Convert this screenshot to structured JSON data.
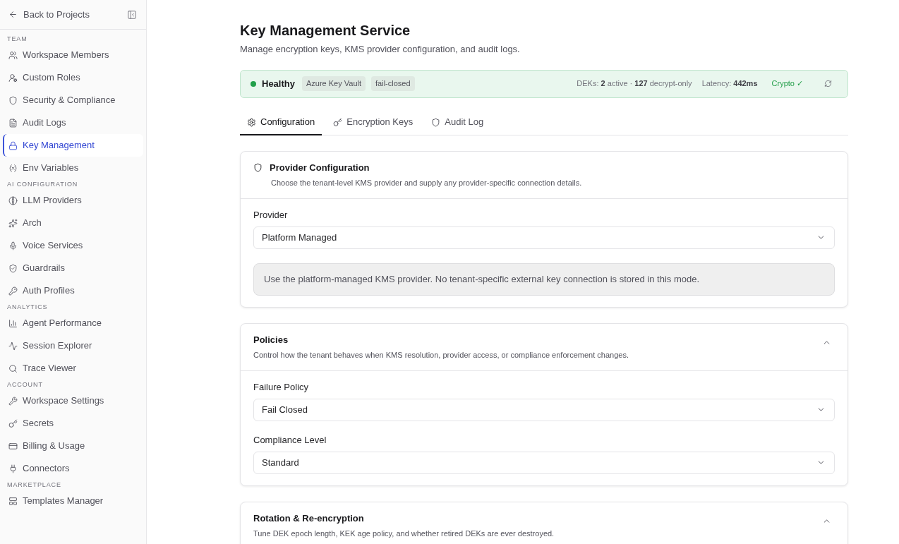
{
  "sidebar": {
    "back_link": "Back to Projects",
    "sections": [
      {
        "title": "TEAM",
        "items": [
          {
            "label": "Workspace Members",
            "selected": false
          },
          {
            "label": "Custom Roles",
            "selected": false
          },
          {
            "label": "Security & Compliance",
            "selected": false
          },
          {
            "label": "Audit Logs",
            "selected": false
          },
          {
            "label": "Key Management",
            "selected": true
          },
          {
            "label": "Env Variables",
            "selected": false
          }
        ]
      },
      {
        "title": "AI CONFIGURATION",
        "items": [
          {
            "label": "LLM Providers",
            "selected": false
          },
          {
            "label": "Arch",
            "selected": false
          },
          {
            "label": "Voice Services",
            "selected": false
          },
          {
            "label": "Guardrails",
            "selected": false
          },
          {
            "label": "Auth Profiles",
            "selected": false
          }
        ]
      },
      {
        "title": "ANALYTICS",
        "items": [
          {
            "label": "Agent Performance",
            "selected": false
          },
          {
            "label": "Session Explorer",
            "selected": false
          },
          {
            "label": "Trace Viewer",
            "selected": false
          }
        ]
      },
      {
        "title": "ACCOUNT",
        "items": [
          {
            "label": "Workspace Settings",
            "selected": false
          },
          {
            "label": "Secrets",
            "selected": false
          },
          {
            "label": "Billing & Usage",
            "selected": false
          },
          {
            "label": "Connectors",
            "selected": false
          }
        ]
      },
      {
        "title": "MARKETPLACE",
        "items": [
          {
            "label": "Templates Manager",
            "selected": false
          }
        ]
      }
    ]
  },
  "page": {
    "title": "Key Management Service",
    "subtitle": "Manage encryption keys, KMS provider configuration, and audit logs."
  },
  "status_banner": {
    "kind": "healthy",
    "status": "Healthy",
    "provider_badge": "Azure Key Vault",
    "policy_badge": "fail-closed",
    "deks": "DEKs: **2** active · **127** decrypt-only",
    "latency": "Latency: **442ms**",
    "crypto": "Crypto ✓"
  },
  "tabs": [
    {
      "label": "Configuration",
      "selected": true
    },
    {
      "label": "Encryption Keys",
      "selected": false
    },
    {
      "label": "Audit Log",
      "selected": false
    }
  ],
  "cards": [
    {
      "kind": "icon",
      "title": "Provider Configuration",
      "description": "Choose the tenant-level KMS provider and supply any provider-specific connection details.",
      "fields": [
        {
          "kind": "select",
          "label": "Provider",
          "value": "Platform Managed"
        },
        {
          "kind": "note",
          "text": "Use the platform-managed KMS provider. No tenant-specific external key connection is stored in this mode."
        }
      ]
    },
    {
      "kind": "collapsible",
      "expanded": true,
      "title": "Policies",
      "description": "Control how the tenant behaves when KMS resolution, provider access, or compliance enforcement changes.",
      "fields": [
        {
          "kind": "select",
          "label": "Failure Policy",
          "value": "Fail Closed"
        },
        {
          "kind": "select",
          "label": "Compliance Level",
          "value": "Standard"
        }
      ]
    },
    {
      "kind": "collapsible",
      "expanded": true,
      "title": "Rotation & Re-encryption",
      "description": "Tune DEK epoch length, KEK age policy, and whether retired DEKs are ever destroyed."
    }
  ]
}
